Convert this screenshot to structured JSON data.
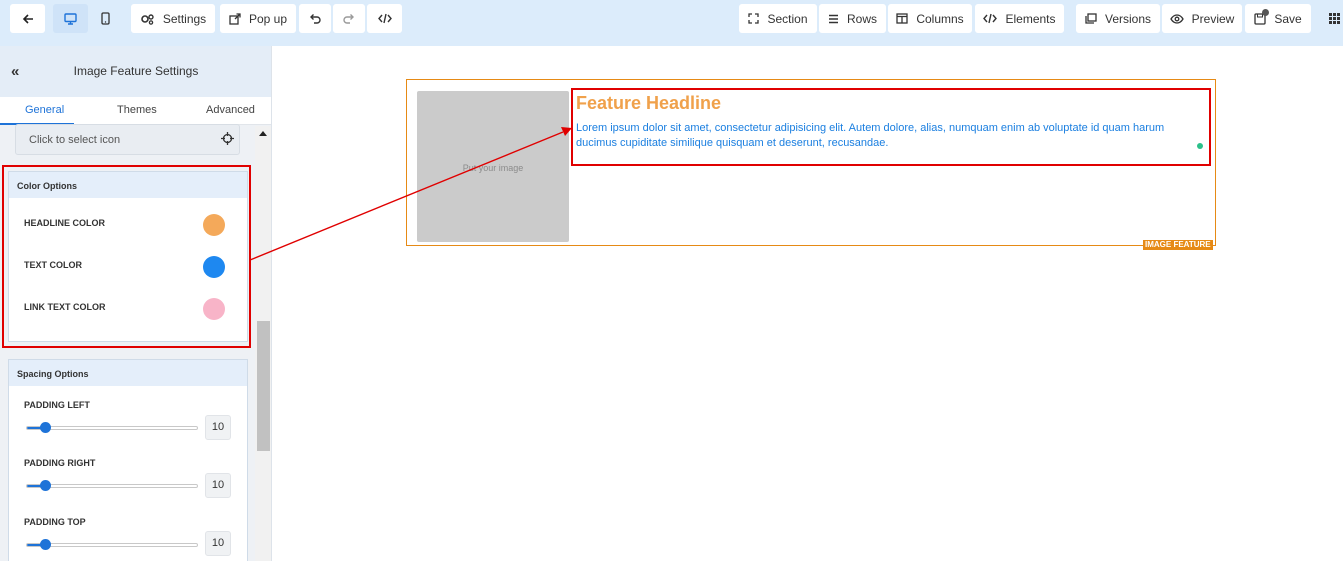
{
  "toolbar": {
    "back_icon": "arrow-left-icon",
    "desktop_icon": "monitor-icon",
    "mobile_icon": "smartphone-icon",
    "settings_label": "Settings",
    "popup_label": "Pop up",
    "undo_icon": "undo-icon",
    "redo_icon": "redo-icon",
    "code_icon": "code-icon",
    "section_label": "Section",
    "rows_label": "Rows",
    "columns_label": "Columns",
    "elements_label": "Elements",
    "versions_label": "Versions",
    "preview_label": "Preview",
    "save_label": "Save",
    "grid_icon": "grid-icon"
  },
  "sidebar": {
    "title": "Image Feature Settings",
    "back_symbol": "«",
    "tabs": [
      {
        "label": "General",
        "active": true
      },
      {
        "label": "Themes",
        "active": false
      },
      {
        "label": "Advanced",
        "active": false
      }
    ],
    "icon_select_placeholder": "Click to select icon",
    "color_options": {
      "title": "Color Options",
      "rows": [
        {
          "label": "HEADLINE COLOR",
          "color": "#f4a95a"
        },
        {
          "label": "TEXT COLOR",
          "color": "#1e88f0"
        },
        {
          "label": "LINK TEXT COLOR",
          "color": "#f8b4c8"
        }
      ]
    },
    "spacing_options": {
      "title": "Spacing Options",
      "rows": [
        {
          "label": "PADDING LEFT",
          "value": "10"
        },
        {
          "label": "PADDING RIGHT",
          "value": "10"
        },
        {
          "label": "PADDING TOP",
          "value": "10"
        }
      ]
    }
  },
  "canvas": {
    "image_placeholder": "Put your image",
    "headline": "Feature Headline",
    "text": "Lorem ipsum dolor sit amet, consectetur adipisicing elit. Autem dolore, alias, numquam enim ab voluptate id quam harum ducimus cupiditate similique quisquam et deserunt, recusandae.",
    "badge": "IMAGE FEATURE"
  },
  "colors": {
    "accent": "#1e73d8",
    "highlight": "#e00000",
    "feature_border": "#e68a15"
  }
}
